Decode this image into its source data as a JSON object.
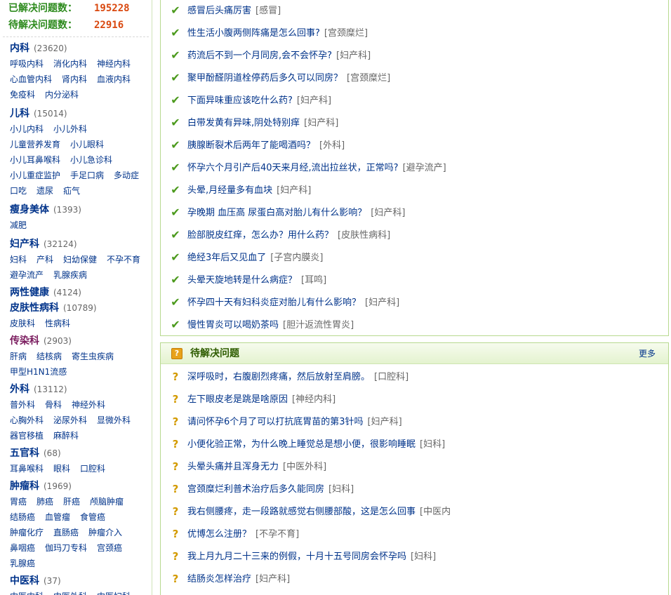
{
  "stats": {
    "solved_label": "已解决问题数：",
    "solved_value": "195228",
    "pending_label": "待解决问题数：",
    "pending_value": "22916"
  },
  "categories": [
    {
      "name": "内科",
      "count": "(23620)",
      "subs": [
        [
          "呼吸内科",
          "消化内科",
          "神经内科"
        ],
        [
          "心血管内科",
          "肾内科",
          "血液内科"
        ],
        [
          "免疫科",
          "内分泌科"
        ]
      ]
    },
    {
      "name": "儿科",
      "count": "(15014)",
      "subs": [
        [
          "小儿内科",
          "小儿外科"
        ],
        [
          "儿童营养发育",
          "小儿眼科"
        ],
        [
          "小儿耳鼻喉科",
          "小儿急诊科"
        ],
        [
          "小儿重症监护",
          "手足口病",
          "多动症"
        ],
        [
          "口吃",
          "遗尿",
          "疝气"
        ]
      ]
    },
    {
      "name": "瘦身美体",
      "count": "(1393)",
      "subs": [
        [
          "减肥"
        ]
      ]
    },
    {
      "name": "妇产科",
      "count": "(32124)",
      "subs": [
        [
          "妇科",
          "产科",
          "妇幼保健",
          "不孕不育"
        ],
        [
          "避孕流产",
          "乳腺疾病"
        ]
      ]
    },
    {
      "name": "两性健康",
      "count": "(4124)",
      "subs": []
    },
    {
      "name": "皮肤性病科",
      "count": "(10789)",
      "subs": [
        [
          "皮肤科",
          "性病科"
        ]
      ]
    },
    {
      "name": "传染科",
      "count": "(2903)",
      "subs": [
        [
          "肝病",
          "结核病",
          "寄生虫疾病"
        ],
        [
          "甲型H1N1流感"
        ]
      ]
    },
    {
      "name": "外科",
      "count": "(13112)",
      "subs": [
        [
          "普外科",
          "骨科",
          "神经外科"
        ],
        [
          "心胸外科",
          "泌尿外科",
          "显微外科"
        ],
        [
          "器官移植",
          "麻醉科"
        ]
      ]
    },
    {
      "name": "五官科",
      "count": "(68)",
      "subs": [
        [
          "耳鼻喉科",
          "眼科",
          "口腔科"
        ]
      ]
    },
    {
      "name": "肿瘤科",
      "count": "(1969)",
      "subs": [
        [
          "胃癌",
          "肺癌",
          "肝癌",
          "颅脑肿瘤"
        ],
        [
          "结肠癌",
          "血管瘤",
          "食管癌"
        ],
        [
          "肿瘤化疗",
          "直肠癌",
          "肿瘤介入"
        ],
        [
          "鼻咽癌",
          "伽玛刀专科",
          "宫颈癌"
        ],
        [
          "乳腺癌"
        ]
      ]
    },
    {
      "name": "中医科",
      "count": "(37)",
      "subs": [
        [
          "中医内科",
          "中医外科",
          "中医妇科"
        ]
      ]
    }
  ],
  "solved": {
    "items": [
      {
        "text": "感冒后头痛厉害",
        "tag": "[感冒]"
      },
      {
        "text": "性生活小腹两侧阵痛是怎么回事?",
        "tag": "[宫颈糜烂]"
      },
      {
        "text": "药流后不到一个月同房,会不会怀孕?",
        "tag": "[妇产科]"
      },
      {
        "text": "聚甲酚醛阴道栓停药后多久可以同房？",
        "tag": "[宫颈糜烂]"
      },
      {
        "text": "下面异味重应该吃什么药?",
        "tag": "[妇产科]"
      },
      {
        "text": "白带发黄有异味,阴处特别痒",
        "tag": "[妇产科]"
      },
      {
        "text": "胰腺断裂术后两年了能喝酒吗？",
        "tag": "[外科]"
      },
      {
        "text": "怀孕六个月引产后40天来月经,流出拉丝状，正常吗?",
        "tag": "[避孕流产]"
      },
      {
        "text": "头晕,月经量多有血块",
        "tag": "[妇产科]"
      },
      {
        "text": "孕晚期 血压高 尿蛋白高对胎儿有什么影响？",
        "tag": "[妇产科]"
      },
      {
        "text": "脸部脱皮红痒，怎么办？用什么药？",
        "tag": "[皮肤性病科]"
      },
      {
        "text": "绝经3年后又见血了",
        "tag": "[子宫内膜炎]"
      },
      {
        "text": "头晕天旋地转是什么病症？",
        "tag": "[耳鸣]"
      },
      {
        "text": "怀孕四十天有妇科炎症对胎儿有什么影响？",
        "tag": "[妇产科]"
      },
      {
        "text": "慢性胃炎可以喝奶茶吗",
        "tag": "[胆汁返流性胃炎]"
      }
    ]
  },
  "pending": {
    "title": "待解决问题",
    "more": "更多",
    "icon_char": "?",
    "items": [
      {
        "text": "深呼吸时，右腹剧烈疼痛，然后放射至肩膀。",
        "tag": "[口腔科]"
      },
      {
        "text": "左下眼皮老是跳是啥原因",
        "tag": "[神经内科]"
      },
      {
        "text": "请问怀孕6个月了可以打抗底胃苗的第3针吗",
        "tag": "[妇产科]"
      },
      {
        "text": "小便化验正常，为什么晚上睡觉总是想小便，很影响睡眠",
        "tag": "[妇科]"
      },
      {
        "text": "头晕头痛并且浑身无力",
        "tag": "[中医外科]"
      },
      {
        "text": "宫颈糜烂利普术治疗后多久能同房",
        "tag": "[妇科]"
      },
      {
        "text": "我右侧腰疼，走一段路就感觉右侧腰部酸，这是怎么回事",
        "tag": "[中医内"
      },
      {
        "text": "优博怎么注册？",
        "tag": "[不孕不育]"
      },
      {
        "text": "我上月九月二十三来的例假，十月十五号同房会怀孕吗",
        "tag": "[妇科]"
      },
      {
        "text": "结肠炎怎样治疗",
        "tag": "[妇产科]"
      }
    ]
  },
  "colors": {
    "accent_green": "#2e8b1e",
    "number_orange": "#d9480f",
    "link_blue": "#00338a",
    "border_green": "#b7d98f"
  },
  "icons": {
    "solved_mark": "check-icon",
    "pending_mark": "question-icon",
    "panel_icon": "question-box-icon"
  }
}
